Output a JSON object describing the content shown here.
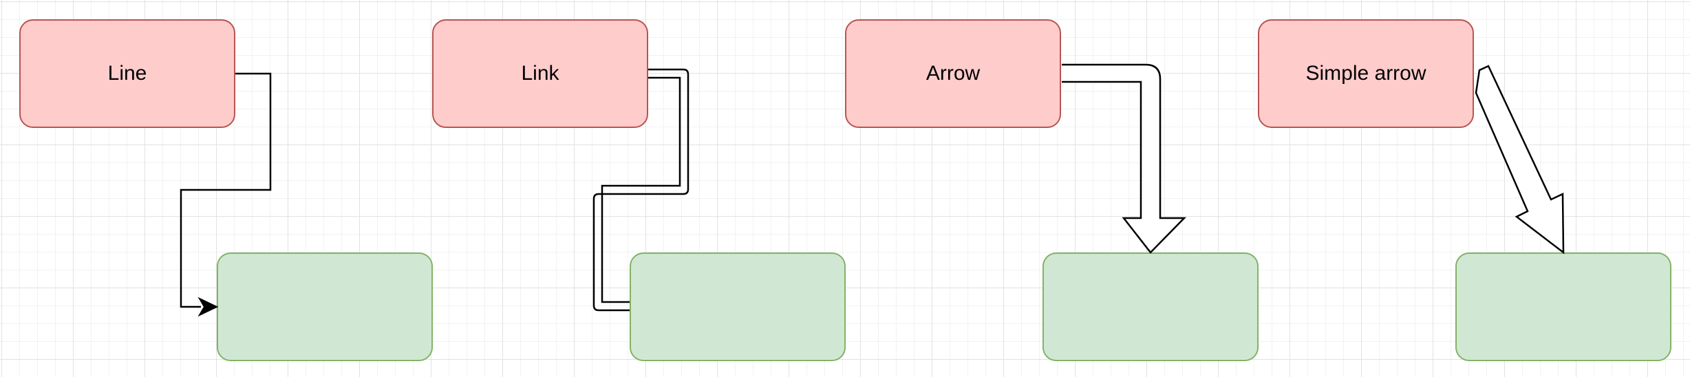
{
  "diagram": {
    "columns": [
      {
        "source_label": "Line"
      },
      {
        "source_label": "Link"
      },
      {
        "source_label": "Arrow"
      },
      {
        "source_label": "Simple arrow"
      }
    ]
  },
  "colors": {
    "source_fill": "#ffcccc",
    "source_stroke": "#b85450",
    "target_fill": "#d0e8d3",
    "target_stroke": "#82b366",
    "edge_stroke": "#000000",
    "grid_major": "#e2e2e2",
    "grid_minor": "#f2f2f2"
  }
}
